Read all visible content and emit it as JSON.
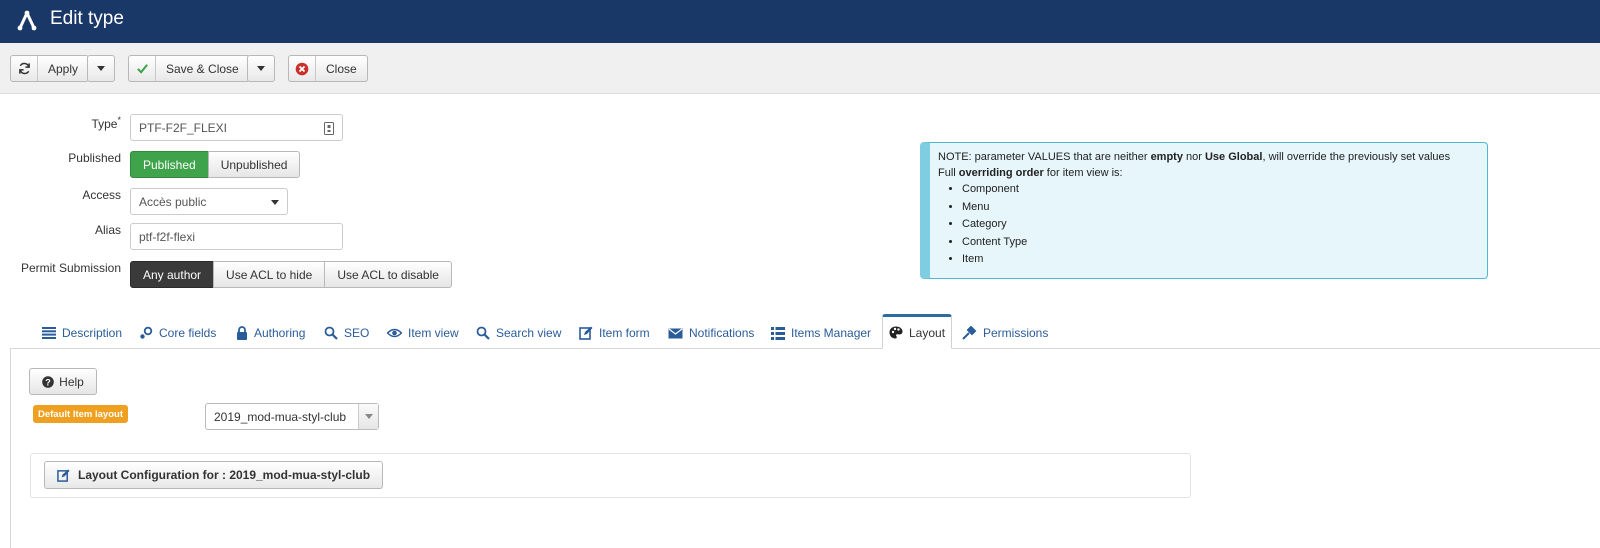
{
  "header": {
    "title": "Edit type",
    "logo_icon": "joomla-icon"
  },
  "toolbar": {
    "apply_label": "Apply",
    "save_close_label": "Save & Close",
    "close_label": "Close"
  },
  "form": {
    "type": {
      "label": "Type",
      "required_mark": "*",
      "value": "PTF-F2F_FLEXI"
    },
    "published": {
      "label": "Published",
      "options": [
        "Published",
        "Unpublished"
      ],
      "selected": "Published"
    },
    "access": {
      "label": "Access",
      "value": "Accès public"
    },
    "alias": {
      "label": "Alias",
      "value": "ptf-f2f-flexi"
    },
    "permit_submission": {
      "label": "Permit Submission",
      "options": [
        "Any author",
        "Use ACL to hide",
        "Use ACL to disable"
      ],
      "selected": "Any author"
    }
  },
  "note": {
    "line1_a": "NOTE: parameter VALUES that are neither ",
    "line1_b": "empty",
    "line1_c": " nor ",
    "line1_d": "Use Global",
    "line1_e": ", will override the previously set values",
    "line2_a": "Full ",
    "line2_b": "overriding order",
    "line2_c": " for item view is:",
    "items": [
      "Component",
      "Menu",
      "Category",
      "Content Type",
      "Item"
    ]
  },
  "tabs": [
    {
      "label": "Description",
      "icon": "list-icon"
    },
    {
      "label": "Core fields",
      "icon": "link-icon"
    },
    {
      "label": "Authoring",
      "icon": "lock-icon"
    },
    {
      "label": "SEO",
      "icon": "search-icon"
    },
    {
      "label": "Item view",
      "icon": "eye-icon"
    },
    {
      "label": "Search view",
      "icon": "search-icon"
    },
    {
      "label": "Item form",
      "icon": "edit-icon"
    },
    {
      "label": "Notifications",
      "icon": "envelope-icon"
    },
    {
      "label": "Items Manager",
      "icon": "list-icon"
    },
    {
      "label": "Layout",
      "icon": "palette-icon"
    },
    {
      "label": "Permissions",
      "icon": "wrench-icon"
    }
  ],
  "active_tab": "Layout",
  "layout_panel": {
    "help_label": "Help",
    "default_layout_badge": "Default Item layout",
    "default_layout_value": "2019_mod-mua-styl-club",
    "layout_config_label": "Layout Configuration for : 2019_mod-mua-styl-club"
  },
  "colors": {
    "header_bg": "#1a3867",
    "published_green": "#3ea34a",
    "selected_dark": "#3a3a3a",
    "badge_orange": "#f0a020",
    "note_bg": "#e6f6fa",
    "link_blue": "#2a5c99"
  }
}
